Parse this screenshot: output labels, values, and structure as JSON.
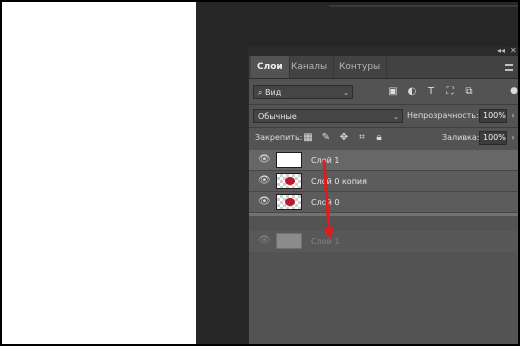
{
  "panel": {
    "controls": {
      "collapse": "◂◂",
      "close": "✕"
    },
    "tabs": [
      "Слои",
      "Каналы",
      "Контуры"
    ],
    "filter": {
      "selected": "Вид",
      "icon": "search-icon"
    },
    "filter_icons": [
      "image-icon",
      "circle-half-icon",
      "text-icon",
      "transform-icon",
      "smart-object-icon"
    ],
    "blend_mode": "Обычные",
    "opacity": {
      "label": "Непрозрачность:",
      "value": "100%"
    },
    "lock": {
      "label": "Закрепить:",
      "icons": [
        "lock-pixels-icon",
        "lock-brush-icon",
        "lock-move-icon",
        "lock-artboard-icon",
        "lock-all-icon"
      ]
    },
    "fill": {
      "label": "Заливка:",
      "value": "100%"
    },
    "layers": [
      {
        "name": "Слой 1",
        "thumbnail": "white",
        "selected": true
      },
      {
        "name": "Слой 0 копия",
        "thumbnail": "red-object",
        "selected": false
      },
      {
        "name": "Слой 0",
        "thumbnail": "red-object",
        "selected": false
      }
    ],
    "dragged_layer": {
      "name": "Слой 1",
      "thumbnail": "gray"
    }
  },
  "annotation": {
    "color": "#e01b1b",
    "type": "arrow-down"
  }
}
